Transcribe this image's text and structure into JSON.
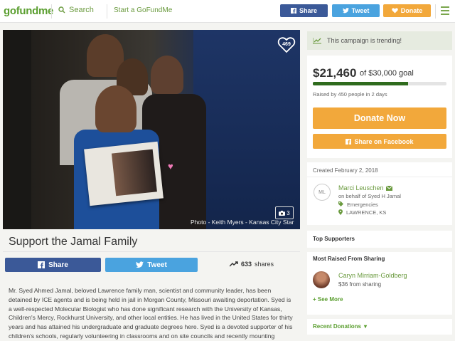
{
  "header": {
    "logo": "gofundme",
    "search_label": "Search",
    "start_label": "Start a GoFundMe",
    "share_label": "Share",
    "tweet_label": "Tweet",
    "donate_label": "Donate"
  },
  "hero": {
    "heart_count": "469",
    "photo_credit": "Photo - Keith Myers - Kansas City Star",
    "photo_count": "3"
  },
  "campaign": {
    "title": "Support the Jamal Family",
    "share_label": "Share",
    "tweet_label": "Tweet",
    "shares_count": "633",
    "shares_label": "shares",
    "story": "Mr. Syed Ahmed Jamal, beloved Lawrence family man, scientist and community leader, has been detained by ICE agents and is being held in jail in Morgan County, Missouri awaiting deportation.  Syed is a well-respected Molecular Biologist who has done significant research with the University of Kansas, Children's Mercy, Rockhurst University, and other local entities.  He has lived in the United States for thirty years and has attained his undergraduate and graduate degrees here.  Syed is a devoted supporter of his children's schools, regularly volunteering in classrooms and on site councils and recently mounting"
  },
  "sidebar": {
    "trending_text": "This campaign is trending!",
    "amount": "$21,460",
    "goal_text": "of $30,000 goal",
    "progress_fraction": 0.7153,
    "raised_text": "Raised by 450 people in 2 days",
    "donate_now_label": "Donate Now",
    "share_fb_label": "Share on Facebook",
    "created_text": "Created February 2, 2018",
    "organizer": {
      "initials": "ML",
      "name": "Marci Leuschen",
      "on_behalf": "on behalf of Syed H Jamal",
      "category": "Emergencies",
      "location": "LAWRENCE, KS"
    },
    "top_supporters_label": "Top Supporters",
    "most_raised_label": "Most Raised From Sharing",
    "top_sharer": {
      "name": "Caryn Mirriam-Goldberg",
      "amount_text": "$36 from sharing"
    },
    "see_more_label": "+ See More",
    "recent_donations_label": "Recent Donations"
  },
  "colors": {
    "brand_green": "#5a9e2f",
    "facebook_blue": "#3b5998",
    "twitter_blue": "#4aa3df",
    "donate_orange": "#f2a83b",
    "progress_green": "#2f6b1d"
  }
}
